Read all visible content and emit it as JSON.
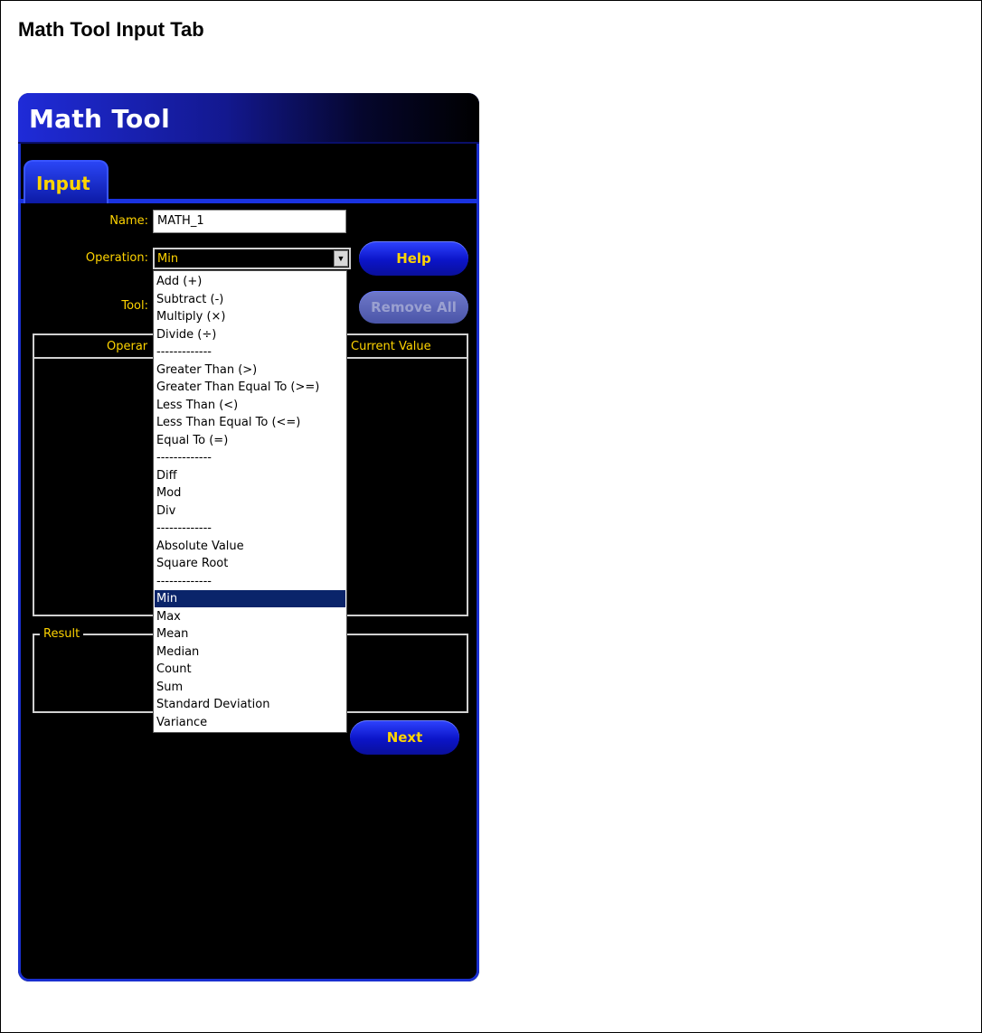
{
  "page_title": "Math Tool Input Tab",
  "window": {
    "title": "Math Tool"
  },
  "tabs": [
    {
      "label": "Input"
    }
  ],
  "form": {
    "name_label": "Name:",
    "name_value": "MATH_1",
    "operation_label": "Operation:",
    "operation_value": "Min",
    "tool_label": "Tool:"
  },
  "buttons": {
    "help": "Help",
    "remove_all": "Remove All",
    "next": "Next"
  },
  "table": {
    "columns": [
      "Operand",
      "Current Value"
    ],
    "visible_header_left": "Operar"
  },
  "result": {
    "legend": "Result"
  },
  "dropdown": {
    "items": [
      "Add (+)",
      "Subtract (-)",
      "Multiply (×)",
      "Divide (÷)",
      "-------------",
      "Greater Than (>)",
      "Greater Than Equal To (>=)",
      "Less Than (<)",
      "Less Than Equal To (<=)",
      "Equal To (=)",
      "-------------",
      "Diff",
      "Mod",
      "Div",
      "-------------",
      "Absolute Value",
      "Square Root",
      "-------------",
      "Min",
      "Max",
      "Mean",
      "Median",
      "Count",
      "Sum",
      "Standard Deviation",
      "Variance"
    ],
    "selected": "Min"
  },
  "colors": {
    "accent": "#ffd400",
    "window_bg": "#000000",
    "brand_blue": "#1a33e0",
    "selection": "#0a246a"
  }
}
